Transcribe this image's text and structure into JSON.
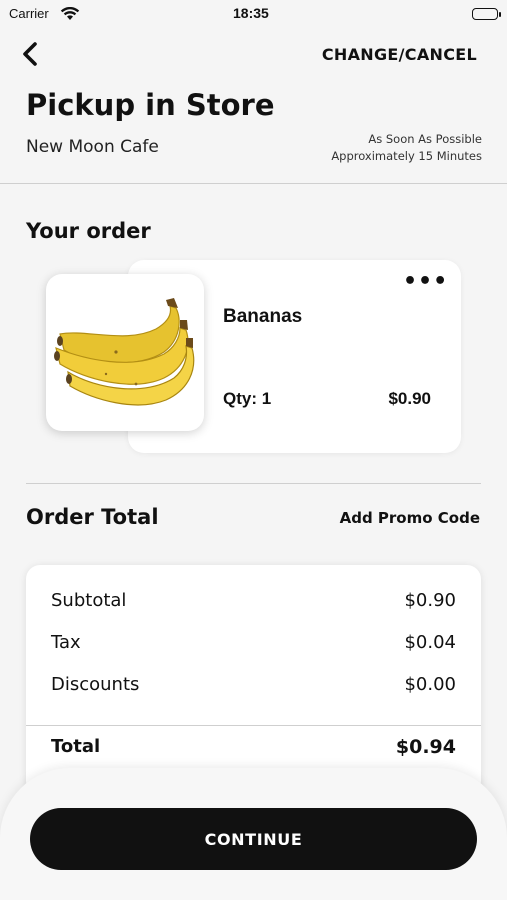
{
  "status_bar": {
    "carrier": "Carrier",
    "time": "18:35",
    "battery_level": 1.0
  },
  "header": {
    "back_icon": "chevron-left-icon",
    "action_label": "CHANGE/CANCEL",
    "title": "Pickup in Store",
    "store_name": "New Moon Cafe",
    "eta_line1": "As Soon As Possible",
    "eta_line2": "Approximately 15 Minutes"
  },
  "order": {
    "section_title": "Your order",
    "items": [
      {
        "name": "Bananas",
        "qty_label": "Qty: 1",
        "price": "$0.90",
        "image_icon": "bananas-image",
        "more_icon": "ellipsis-icon",
        "more_label": "•••"
      }
    ]
  },
  "totals": {
    "section_title": "Order Total",
    "promo_label": "Add Promo Code",
    "rows": [
      {
        "label": "Subtotal",
        "value": "$0.90"
      },
      {
        "label": "Tax",
        "value": "$0.04"
      },
      {
        "label": "Discounts",
        "value": "$0.00"
      }
    ],
    "total": {
      "label": "Total",
      "value": "$0.94"
    }
  },
  "footer": {
    "continue_label": "CONTINUE"
  },
  "colors": {
    "background": "#f5f5f5",
    "primary": "#111111",
    "banana_yellow": "#f1cd3a"
  }
}
